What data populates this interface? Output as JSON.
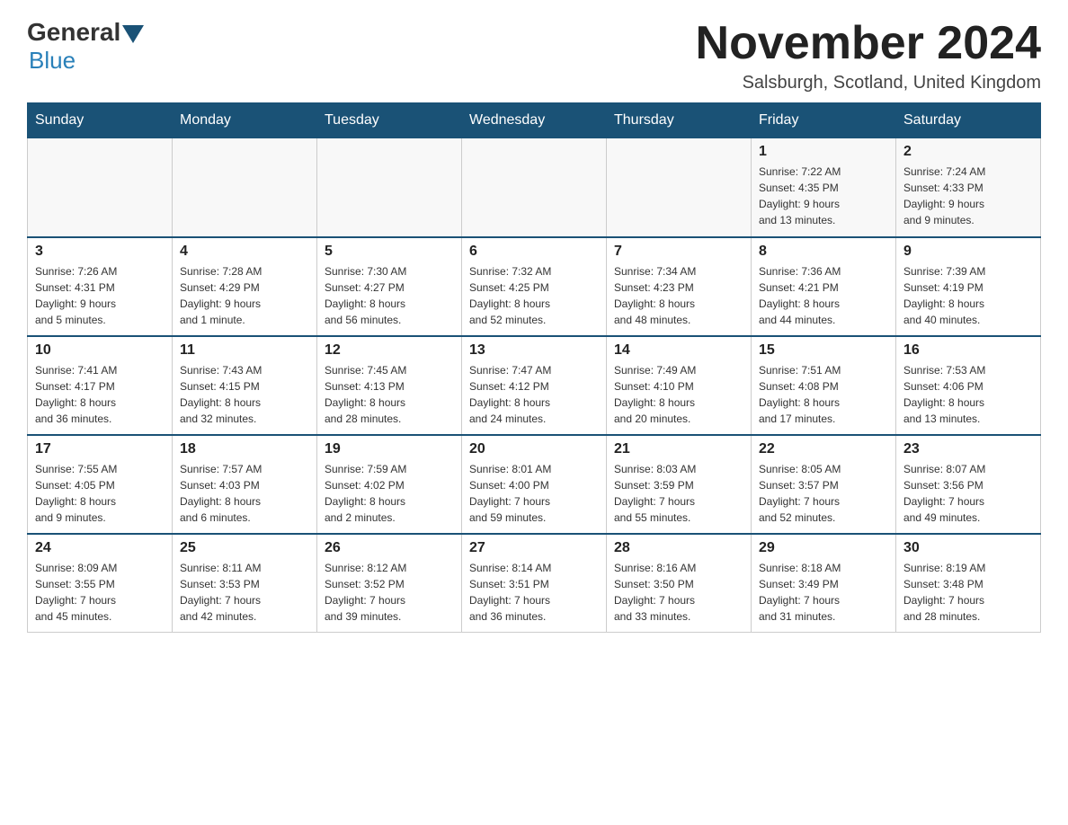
{
  "header": {
    "logo": {
      "general": "General",
      "blue": "Blue"
    },
    "title": "November 2024",
    "location": "Salsburgh, Scotland, United Kingdom"
  },
  "weekdays": [
    "Sunday",
    "Monday",
    "Tuesday",
    "Wednesday",
    "Thursday",
    "Friday",
    "Saturday"
  ],
  "weeks": [
    [
      {
        "day": "",
        "info": ""
      },
      {
        "day": "",
        "info": ""
      },
      {
        "day": "",
        "info": ""
      },
      {
        "day": "",
        "info": ""
      },
      {
        "day": "",
        "info": ""
      },
      {
        "day": "1",
        "info": "Sunrise: 7:22 AM\nSunset: 4:35 PM\nDaylight: 9 hours\nand 13 minutes."
      },
      {
        "day": "2",
        "info": "Sunrise: 7:24 AM\nSunset: 4:33 PM\nDaylight: 9 hours\nand 9 minutes."
      }
    ],
    [
      {
        "day": "3",
        "info": "Sunrise: 7:26 AM\nSunset: 4:31 PM\nDaylight: 9 hours\nand 5 minutes."
      },
      {
        "day": "4",
        "info": "Sunrise: 7:28 AM\nSunset: 4:29 PM\nDaylight: 9 hours\nand 1 minute."
      },
      {
        "day": "5",
        "info": "Sunrise: 7:30 AM\nSunset: 4:27 PM\nDaylight: 8 hours\nand 56 minutes."
      },
      {
        "day": "6",
        "info": "Sunrise: 7:32 AM\nSunset: 4:25 PM\nDaylight: 8 hours\nand 52 minutes."
      },
      {
        "day": "7",
        "info": "Sunrise: 7:34 AM\nSunset: 4:23 PM\nDaylight: 8 hours\nand 48 minutes."
      },
      {
        "day": "8",
        "info": "Sunrise: 7:36 AM\nSunset: 4:21 PM\nDaylight: 8 hours\nand 44 minutes."
      },
      {
        "day": "9",
        "info": "Sunrise: 7:39 AM\nSunset: 4:19 PM\nDaylight: 8 hours\nand 40 minutes."
      }
    ],
    [
      {
        "day": "10",
        "info": "Sunrise: 7:41 AM\nSunset: 4:17 PM\nDaylight: 8 hours\nand 36 minutes."
      },
      {
        "day": "11",
        "info": "Sunrise: 7:43 AM\nSunset: 4:15 PM\nDaylight: 8 hours\nand 32 minutes."
      },
      {
        "day": "12",
        "info": "Sunrise: 7:45 AM\nSunset: 4:13 PM\nDaylight: 8 hours\nand 28 minutes."
      },
      {
        "day": "13",
        "info": "Sunrise: 7:47 AM\nSunset: 4:12 PM\nDaylight: 8 hours\nand 24 minutes."
      },
      {
        "day": "14",
        "info": "Sunrise: 7:49 AM\nSunset: 4:10 PM\nDaylight: 8 hours\nand 20 minutes."
      },
      {
        "day": "15",
        "info": "Sunrise: 7:51 AM\nSunset: 4:08 PM\nDaylight: 8 hours\nand 17 minutes."
      },
      {
        "day": "16",
        "info": "Sunrise: 7:53 AM\nSunset: 4:06 PM\nDaylight: 8 hours\nand 13 minutes."
      }
    ],
    [
      {
        "day": "17",
        "info": "Sunrise: 7:55 AM\nSunset: 4:05 PM\nDaylight: 8 hours\nand 9 minutes."
      },
      {
        "day": "18",
        "info": "Sunrise: 7:57 AM\nSunset: 4:03 PM\nDaylight: 8 hours\nand 6 minutes."
      },
      {
        "day": "19",
        "info": "Sunrise: 7:59 AM\nSunset: 4:02 PM\nDaylight: 8 hours\nand 2 minutes."
      },
      {
        "day": "20",
        "info": "Sunrise: 8:01 AM\nSunset: 4:00 PM\nDaylight: 7 hours\nand 59 minutes."
      },
      {
        "day": "21",
        "info": "Sunrise: 8:03 AM\nSunset: 3:59 PM\nDaylight: 7 hours\nand 55 minutes."
      },
      {
        "day": "22",
        "info": "Sunrise: 8:05 AM\nSunset: 3:57 PM\nDaylight: 7 hours\nand 52 minutes."
      },
      {
        "day": "23",
        "info": "Sunrise: 8:07 AM\nSunset: 3:56 PM\nDaylight: 7 hours\nand 49 minutes."
      }
    ],
    [
      {
        "day": "24",
        "info": "Sunrise: 8:09 AM\nSunset: 3:55 PM\nDaylight: 7 hours\nand 45 minutes."
      },
      {
        "day": "25",
        "info": "Sunrise: 8:11 AM\nSunset: 3:53 PM\nDaylight: 7 hours\nand 42 minutes."
      },
      {
        "day": "26",
        "info": "Sunrise: 8:12 AM\nSunset: 3:52 PM\nDaylight: 7 hours\nand 39 minutes."
      },
      {
        "day": "27",
        "info": "Sunrise: 8:14 AM\nSunset: 3:51 PM\nDaylight: 7 hours\nand 36 minutes."
      },
      {
        "day": "28",
        "info": "Sunrise: 8:16 AM\nSunset: 3:50 PM\nDaylight: 7 hours\nand 33 minutes."
      },
      {
        "day": "29",
        "info": "Sunrise: 8:18 AM\nSunset: 3:49 PM\nDaylight: 7 hours\nand 31 minutes."
      },
      {
        "day": "30",
        "info": "Sunrise: 8:19 AM\nSunset: 3:48 PM\nDaylight: 7 hours\nand 28 minutes."
      }
    ]
  ]
}
